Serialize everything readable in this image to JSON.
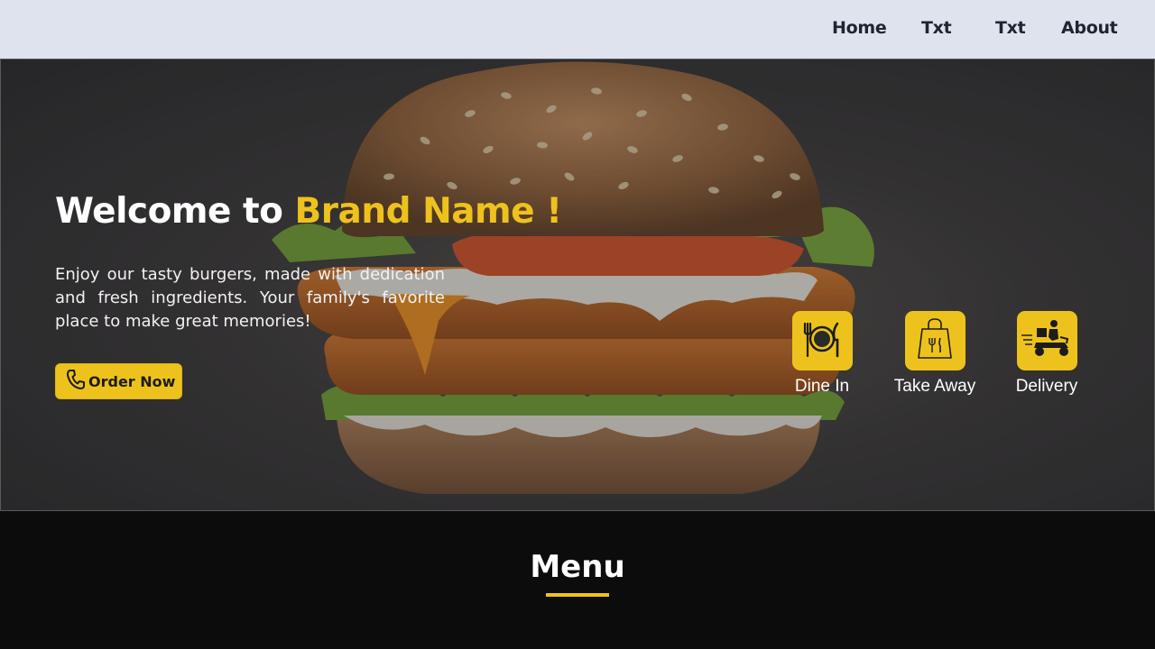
{
  "nav": {
    "items": [
      {
        "label": "Home"
      },
      {
        "label": "Txt"
      },
      {
        "label": "Txt"
      },
      {
        "label": "About"
      }
    ]
  },
  "hero": {
    "title_prefix": "Welcome to ",
    "brand_name": "Brand Name !",
    "description": "Enjoy our tasty burgers, made with dedication and fresh ingredients. Your family's favorite place to make great memories!",
    "order_button": {
      "label": "Order Now",
      "icon": "phone-icon"
    },
    "services": [
      {
        "label": "Dine In",
        "icon": "plate-cutlery-icon"
      },
      {
        "label": "Take Away",
        "icon": "shopping-bag-icon"
      },
      {
        "label": "Delivery",
        "icon": "delivery-scooter-icon"
      }
    ]
  },
  "menu_section": {
    "title": "Menu"
  },
  "colors": {
    "accent": "#eec21d",
    "nav_bg": "#dfe3ee",
    "dark_bg": "#0c0c0c"
  }
}
